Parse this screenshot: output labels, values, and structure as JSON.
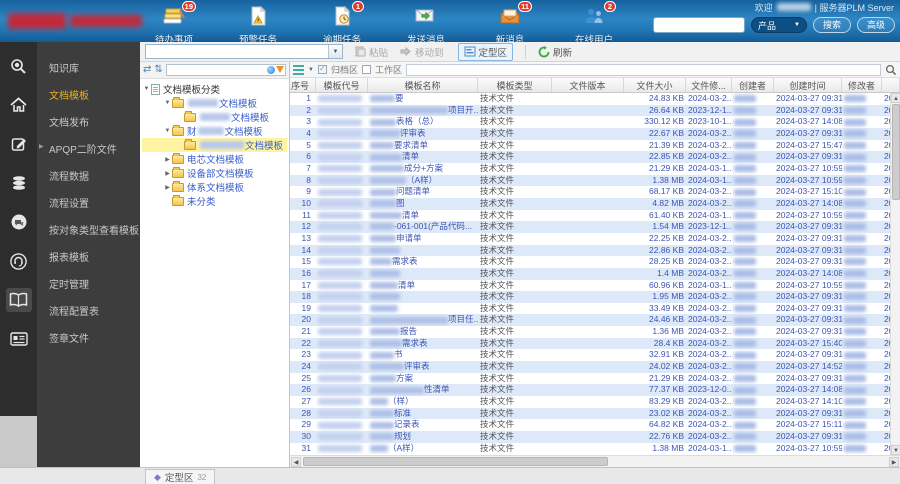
{
  "topbar": {
    "welcome_prefix": "欢迎",
    "welcome_suffix": "| 服务器PLM Server",
    "toolbar": [
      {
        "label": "待办事项",
        "badge": "19",
        "icon": "todo-icon"
      },
      {
        "label": "预警任务",
        "badge": "",
        "icon": "warning-task-icon"
      },
      {
        "label": "逾期任务",
        "badge": "1",
        "icon": "overdue-task-icon"
      },
      {
        "label": "发送消息",
        "badge": "",
        "icon": "send-message-icon"
      },
      {
        "label": "新消息",
        "badge": "11",
        "icon": "new-message-icon"
      },
      {
        "label": "在线用户",
        "badge": "2",
        "icon": "online-users-icon"
      }
    ],
    "search": {
      "value": "",
      "category": "产品",
      "search_label": "搜索",
      "advanced_label": "高级"
    },
    "colors": {
      "bar_blue": "#2e86c4",
      "badge_red": "#e23b2e",
      "logo_red": "#c2293a"
    }
  },
  "rail": {
    "icons": [
      "search-icon",
      "home-icon",
      "edit-icon",
      "database-icon",
      "messages-icon",
      "headset-icon",
      "book-icon",
      "license-icon"
    ],
    "active_index": 6
  },
  "nav": {
    "items": [
      {
        "label": "知识库",
        "active": false,
        "arrow": false
      },
      {
        "label": "文档模板",
        "active": true,
        "arrow": false
      },
      {
        "label": "文档发布",
        "active": false,
        "arrow": false
      },
      {
        "label": "APQP二阶文件",
        "active": false,
        "arrow": true
      },
      {
        "label": "流程数据",
        "active": false,
        "arrow": false
      },
      {
        "label": "流程设置",
        "active": false,
        "arrow": false
      },
      {
        "label": "按对象类型查看模板",
        "active": false,
        "arrow": false
      },
      {
        "label": "报表模板",
        "active": false,
        "arrow": false
      },
      {
        "label": "定时管理",
        "active": false,
        "arrow": false
      },
      {
        "label": "流程配置表",
        "active": false,
        "arrow": false
      },
      {
        "label": "签章文件",
        "active": false,
        "arrow": false
      }
    ],
    "active_color": "#e8b01f"
  },
  "toolbar2": {
    "paste": "粘贴",
    "move": "移动到",
    "zone": "定型区",
    "refresh": "刷新"
  },
  "tree": {
    "root_label": "文档模板分类",
    "items": [
      {
        "lvl": 1,
        "exp": "open",
        "pre": "",
        "blur": 30,
        "label": "文档模板",
        "selected": false
      },
      {
        "lvl": 2,
        "exp": "none",
        "pre": "",
        "blur": 30,
        "label": "文档模板",
        "selected": false
      },
      {
        "lvl": 1,
        "exp": "open",
        "pre": "财",
        "blur": 26,
        "label": "文档模板",
        "selected": false
      },
      {
        "lvl": 2,
        "exp": "none",
        "pre": "",
        "blur": 44,
        "label": "文档模板",
        "selected": true
      },
      {
        "lvl": 1,
        "exp": "closed",
        "pre": "",
        "blur": 0,
        "label": "电芯文档模板",
        "selected": false
      },
      {
        "lvl": 1,
        "exp": "closed",
        "pre": "",
        "blur": 0,
        "label": "设备部文档模板",
        "selected": false
      },
      {
        "lvl": 1,
        "exp": "closed",
        "pre": "",
        "blur": 0,
        "label": "体系文档模板",
        "selected": false
      },
      {
        "lvl": 1,
        "exp": "none",
        "pre": "",
        "blur": 0,
        "label": "未分类",
        "selected": false
      }
    ],
    "selected_bg": "#fdf3a1",
    "link_color": "#3a5ecb"
  },
  "table": {
    "filter": {
      "archive_label": "归档区",
      "archive_checked": true,
      "workspace_label": "工作区",
      "workspace_checked": false,
      "filter_value": ""
    },
    "columns": [
      "序号",
      "模板代号",
      "模板名称",
      "模板类型",
      "文件版本",
      "文件大小",
      "文件修...",
      "创建者",
      "创建时间",
      "修改者",
      ""
    ],
    "type_common": "技术文件",
    "row_stripe": "#dde8f8",
    "rows": [
      {
        "no": "1",
        "name": "要",
        "nb": 25,
        "size": "24.83 KB",
        "fmod": "2024-03-2..",
        "created": "2024-03-27 09:31",
        "mod": "20"
      },
      {
        "no": "2",
        "name": "项目开..",
        "nb": 78,
        "size": "26.64 KB",
        "fmod": "2023-12-1..",
        "created": "2024-03-27 09:31",
        "mod": "20"
      },
      {
        "no": "3",
        "name": "表格（总）",
        "nb": 26,
        "size": "330.12 KB",
        "fmod": "2023-10-1..",
        "created": "2024-03-27 14:08",
        "mod": "20"
      },
      {
        "no": "4",
        "name": "评审表",
        "nb": 30,
        "size": "22.67 KB",
        "fmod": "2024-03-2..",
        "created": "2024-03-27 09:31",
        "mod": "20"
      },
      {
        "no": "5",
        "name": "要求清单",
        "nb": 24,
        "size": "21.39 KB",
        "fmod": "2024-03-2..",
        "created": "2024-03-27 15:47",
        "mod": "20"
      },
      {
        "no": "6",
        "name": "清单",
        "nb": 32,
        "size": "22.85 KB",
        "fmod": "2024-03-2..",
        "created": "2024-03-27 09:31",
        "mod": "20"
      },
      {
        "no": "7",
        "name": "成分+方案",
        "nb": 34,
        "size": "21.29 KB",
        "fmod": "2024-03-1..",
        "created": "2024-03-27 10:59",
        "mod": "20"
      },
      {
        "no": "8",
        "name": "（A样）",
        "nb": 36,
        "size": "1.38 MB",
        "fmod": "2024-03-1..",
        "created": "2024-03-27 10:59",
        "mod": "20"
      },
      {
        "no": "9",
        "name": "问题清单",
        "nb": 26,
        "size": "68.17 KB",
        "fmod": "2024-03-2..",
        "created": "2024-03-27 15:10",
        "mod": "20"
      },
      {
        "no": "10",
        "name": "图",
        "nb": 26,
        "size": "4.82 MB",
        "fmod": "2024-03-2..",
        "created": "2024-03-27 14:08",
        "mod": "20"
      },
      {
        "no": "11",
        "name": "清单",
        "nb": 32,
        "size": "61.40 KB",
        "fmod": "2024-03-1..",
        "created": "2024-03-27 10:59",
        "mod": "20"
      },
      {
        "no": "12",
        "name": "-061-001(产品代码...",
        "nb": 24,
        "size": "1.54 MB",
        "fmod": "2023-12-1..",
        "created": "2024-03-27 09:31",
        "mod": "20"
      },
      {
        "no": "13",
        "name": "申请单",
        "nb": 26,
        "size": "22.25 KB",
        "fmod": "2024-03-2..",
        "created": "2024-03-27 09:31",
        "mod": "20"
      },
      {
        "no": "14",
        "name": "",
        "nb": 30,
        "size": "22.86 KB",
        "fmod": "2024-03-2..",
        "created": "2024-03-27 09:31",
        "mod": "20"
      },
      {
        "no": "15",
        "name": "需求表",
        "nb": 22,
        "size": "28.25 KB",
        "fmod": "2024-03-2..",
        "created": "2024-03-27 09:31",
        "mod": "20"
      },
      {
        "no": "16",
        "name": "",
        "nb": 30,
        "size": "1.4 MB",
        "fmod": "2024-03-2..",
        "created": "2024-03-27 14:08",
        "mod": "20"
      },
      {
        "no": "17",
        "name": "清单",
        "nb": 28,
        "size": "60.96 KB",
        "fmod": "2024-03-1..",
        "created": "2024-03-27 10:59",
        "mod": "20"
      },
      {
        "no": "18",
        "name": "",
        "nb": 30,
        "size": "1.95 MB",
        "fmod": "2024-03-2..",
        "created": "2024-03-27 09:31",
        "mod": "20"
      },
      {
        "no": "19",
        "name": "",
        "nb": 28,
        "size": "33.49 KB",
        "fmod": "2024-03-2..",
        "created": "2024-03-27 09:31",
        "mod": "20"
      },
      {
        "no": "20",
        "name": "项目任..",
        "nb": 78,
        "size": "24.46 KB",
        "fmod": "2024-03-2..",
        "created": "2024-03-27 09:31",
        "mod": "20"
      },
      {
        "no": "21",
        "name": "报告",
        "nb": 30,
        "size": "1.36 MB",
        "fmod": "2024-03-2..",
        "created": "2024-03-27 09:31",
        "mod": "20"
      },
      {
        "no": "22",
        "name": "需求表",
        "nb": 32,
        "size": "28.4 KB",
        "fmod": "2024-03-2..",
        "created": "2024-03-27 15:40",
        "mod": "20"
      },
      {
        "no": "23",
        "name": "书",
        "nb": 24,
        "size": "32.91 KB",
        "fmod": "2024-03-2..",
        "created": "2024-03-27 09:31",
        "mod": "20"
      },
      {
        "no": "24",
        "name": "评审表",
        "nb": 34,
        "size": "24.02 KB",
        "fmod": "2024-03-2..",
        "created": "2024-03-27 14:52",
        "mod": "20"
      },
      {
        "no": "25",
        "name": "方案",
        "nb": 26,
        "size": "21.29 KB",
        "fmod": "2024-03-2..",
        "created": "2024-03-27 09:31",
        "mod": "20"
      },
      {
        "no": "26",
        "name": "性清单",
        "nb": 54,
        "size": "77.37 KB",
        "fmod": "2023-12-0..",
        "created": "2024-03-27 14:08",
        "mod": "20"
      },
      {
        "no": "27",
        "name": "（样）",
        "nb": 18,
        "size": "83.29 KB",
        "fmod": "2024-03-2..",
        "created": "2024-03-27 14:10",
        "mod": "20"
      },
      {
        "no": "28",
        "name": "标准",
        "nb": 24,
        "size": "23.02 KB",
        "fmod": "2024-03-2..",
        "created": "2024-03-27 09:31",
        "mod": "20"
      },
      {
        "no": "29",
        "name": "记录表",
        "nb": 24,
        "size": "64.82 KB",
        "fmod": "2024-03-2..",
        "created": "2024-03-27 15:11",
        "mod": "20"
      },
      {
        "no": "30",
        "name": "规划",
        "nb": 24,
        "size": "22.76 KB",
        "fmod": "2024-03-2..",
        "created": "2024-03-27 09:31",
        "mod": "20"
      },
      {
        "no": "31",
        "name": "（A样）",
        "nb": 18,
        "size": "1.38 MB",
        "fmod": "2024-03-1..",
        "created": "2024-03-27 10:59",
        "mod": "20"
      }
    ]
  },
  "statusbar": {
    "zone_label": "定型区",
    "zone_count": "32"
  }
}
